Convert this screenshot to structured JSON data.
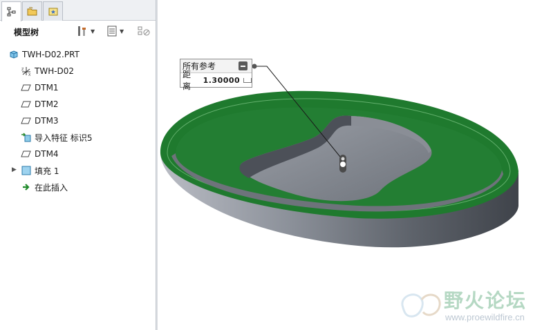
{
  "panel": {
    "tabs": [
      {
        "name": "model-tree-tab",
        "icon": "model-tree-icon"
      },
      {
        "name": "folder-browser-tab",
        "icon": "folder-icon"
      },
      {
        "name": "favorites-tab",
        "icon": "favorites-icon"
      }
    ],
    "title": "模型树",
    "toolbar": {
      "settings_icon": "tools-icon",
      "show_icon": "list-icon",
      "filter_icon": "filter-icon"
    }
  },
  "tree": {
    "items": [
      {
        "label": "TWH-D02.PRT",
        "icon": "part-icon"
      },
      {
        "label": "TWH-D02",
        "icon": "coordinate-system-icon"
      },
      {
        "label": "DTM1",
        "icon": "datum-plane-icon"
      },
      {
        "label": "DTM2",
        "icon": "datum-plane-icon"
      },
      {
        "label": "DTM3",
        "icon": "datum-plane-icon"
      },
      {
        "label": "导入特征 标识5",
        "icon": "import-feature-icon"
      },
      {
        "label": "DTM4",
        "icon": "datum-plane-icon"
      },
      {
        "label": "填充 1",
        "icon": "fill-feature-icon"
      },
      {
        "label": "在此插入",
        "icon": "insert-here-icon"
      }
    ]
  },
  "viewport": {
    "ref_panel": {
      "title": "所有参考",
      "distance_label": "距离",
      "distance_value": "1.30000"
    },
    "colors": {
      "surface_green": "#1f7a2e",
      "body_gray": "#7d828c",
      "accent": "#3a7bd5"
    }
  },
  "watermark": {
    "text_cn": "野火论坛",
    "url": "www.proewildfire.cn"
  }
}
